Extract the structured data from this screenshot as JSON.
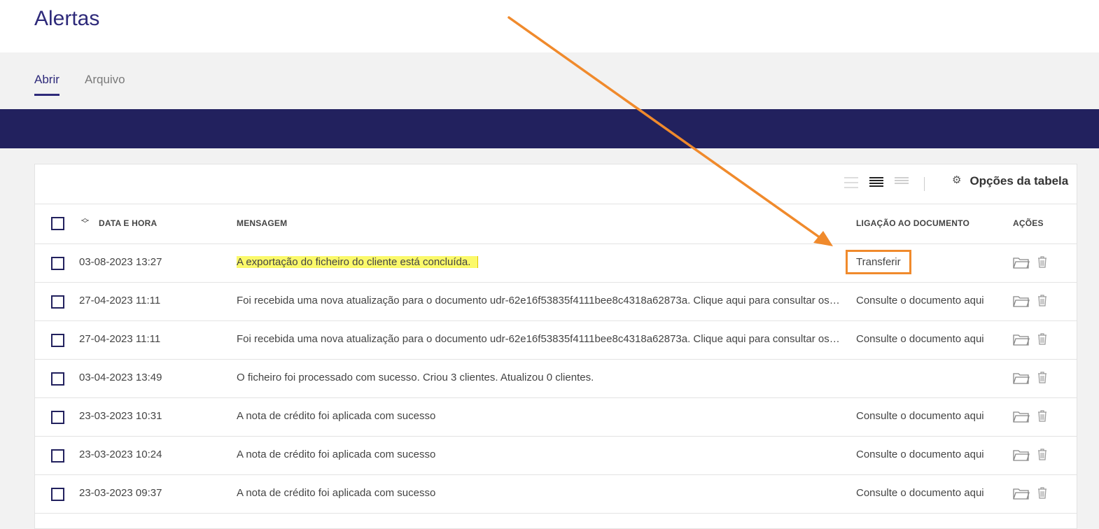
{
  "header": {
    "title": "Alertas"
  },
  "tabs": [
    {
      "label": "Abrir",
      "active": true
    },
    {
      "label": "Arquivo",
      "active": false
    }
  ],
  "toolbar": {
    "table_options_label": "Opções da tabela",
    "gear_icon": "gear-icon"
  },
  "table": {
    "columns": {
      "date": "DATA E HORA",
      "message": "MENSAGEM",
      "link": "LIGAÇÃO AO DOCUMENTO",
      "actions": "AÇÕES"
    },
    "rows": [
      {
        "date": "03-08-2023 13:27",
        "message": "A exportação do ficheiro do cliente está concluída.",
        "link": "Transferir"
      },
      {
        "date": "27-04-2023 11:11",
        "message": "Foi recebida uma nova atualização para o documento udr-62e16f53835f4111bee8c4318a62873a. Clique aqui para consultar os det…",
        "link": "Consulte o documento aqui"
      },
      {
        "date": "27-04-2023 11:11",
        "message": "Foi recebida uma nova atualização para o documento udr-62e16f53835f4111bee8c4318a62873a. Clique aqui para consultar os det…",
        "link": "Consulte o documento aqui"
      },
      {
        "date": "03-04-2023 13:49",
        "message": "O ficheiro foi processado com sucesso. Criou 3 clientes. Atualizou 0 clientes.",
        "link": ""
      },
      {
        "date": "23-03-2023 10:31",
        "message": "A nota de crédito foi aplicada com sucesso",
        "link": "Consulte o documento aqui"
      },
      {
        "date": "23-03-2023 10:24",
        "message": "A nota de crédito foi aplicada com sucesso",
        "link": "Consulte o documento aqui"
      },
      {
        "date": "23-03-2023 09:37",
        "message": "A nota de crédito foi aplicada com sucesso",
        "link": "Consulte o documento aqui"
      }
    ]
  },
  "colors": {
    "primary": "#2e2a7a",
    "banner": "#22215e",
    "highlight_yellow": "#fbf96a",
    "annotation_orange": "#f08a2c"
  }
}
